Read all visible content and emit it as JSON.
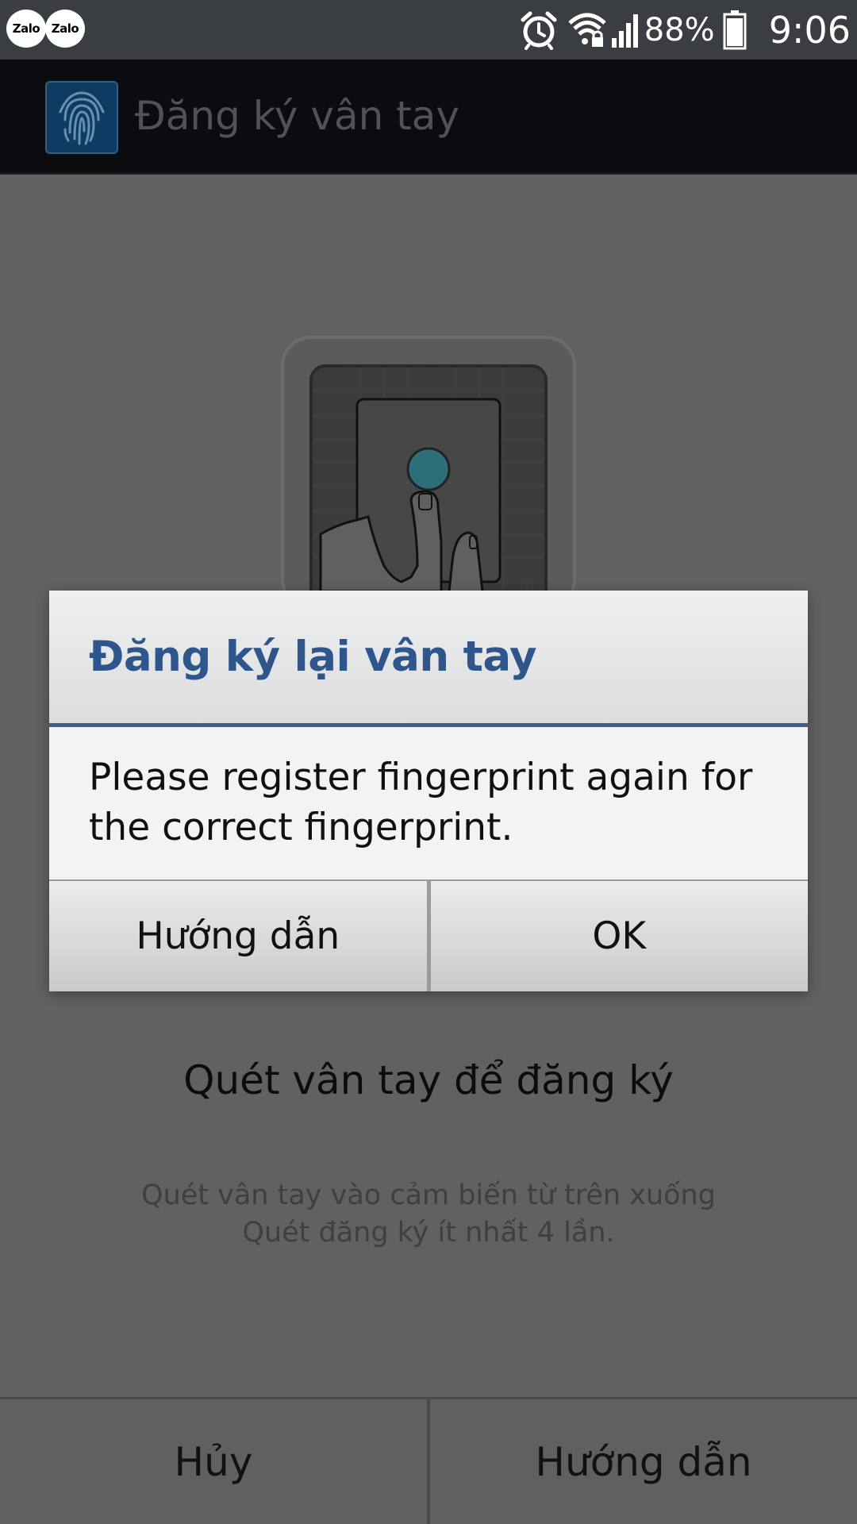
{
  "status_bar": {
    "notifications": [
      "Zalo",
      "Zalo"
    ],
    "icons": [
      "alarm-icon",
      "wifi-lock-icon",
      "signal-icon",
      "battery-icon"
    ],
    "battery_percent": "88%",
    "time": "9:06"
  },
  "action_bar": {
    "app_icon": "fingerprint-icon",
    "title": "Đăng ký vân tay"
  },
  "main": {
    "scan_title": "Quét vân tay để đăng ký",
    "scan_instruction_1": "Quét vân tay vào cảm biến từ trên xuống",
    "scan_instruction_2": "Quét đăng ký ít nhất 4 lần."
  },
  "bottom_buttons": {
    "cancel_label": "Hủy",
    "guide_label": "Hướng dẫn"
  },
  "dialog": {
    "title": "Đăng ký lại vân tay",
    "message": "Please register fingerprint again for the correct fingerprint.",
    "guide_label": "Hướng dẫn",
    "ok_label": "OK"
  },
  "colors": {
    "dialog_title": "#2f568c",
    "dialog_divider": "#3b5f8e",
    "scrim_background": "#606161",
    "sensor_dot": "#2d6f78"
  }
}
